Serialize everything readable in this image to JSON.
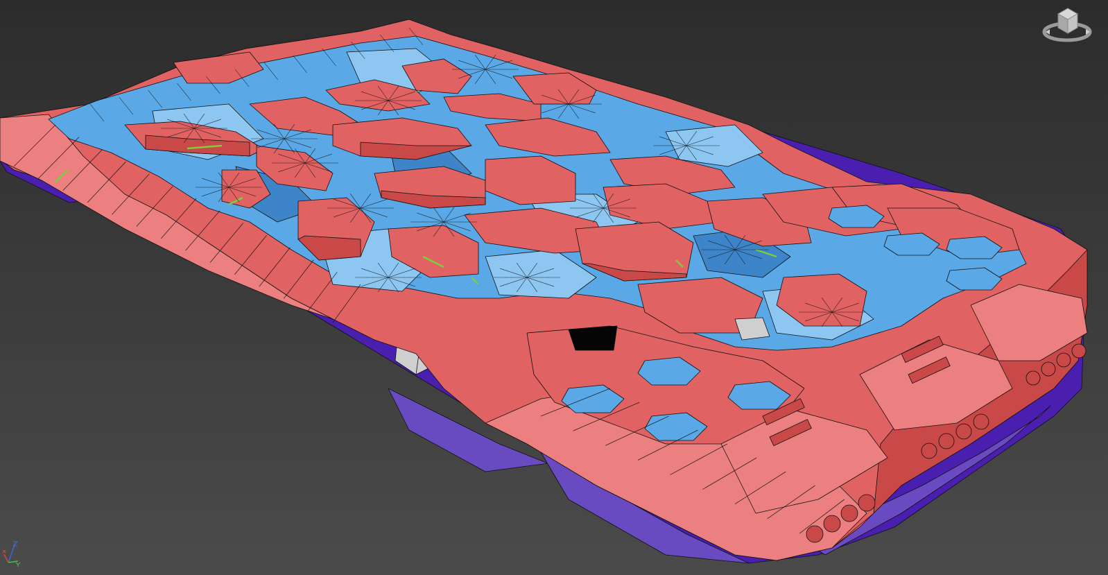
{
  "viewport": {
    "background_top": "#2c2c2c",
    "background_bottom": "#4b4b4b"
  },
  "model": {
    "colors": {
      "hull_red": "#e06262",
      "hull_red_light": "#ec8080",
      "hull_red_dark": "#c94848",
      "floor_blue": "#5aa8e6",
      "floor_blue_light": "#8ec6f2",
      "floor_blue_dark": "#3d85c8",
      "underside_purple": "#4a1fb0",
      "underside_purple_light": "#6a4ac0",
      "engine_grey": "#cfcfcf",
      "wire": "#101010",
      "accent_green": "#7ccf3a"
    }
  },
  "icons": {
    "viewcube": "viewcube-icon",
    "axis": "axis-tripod-icon"
  }
}
